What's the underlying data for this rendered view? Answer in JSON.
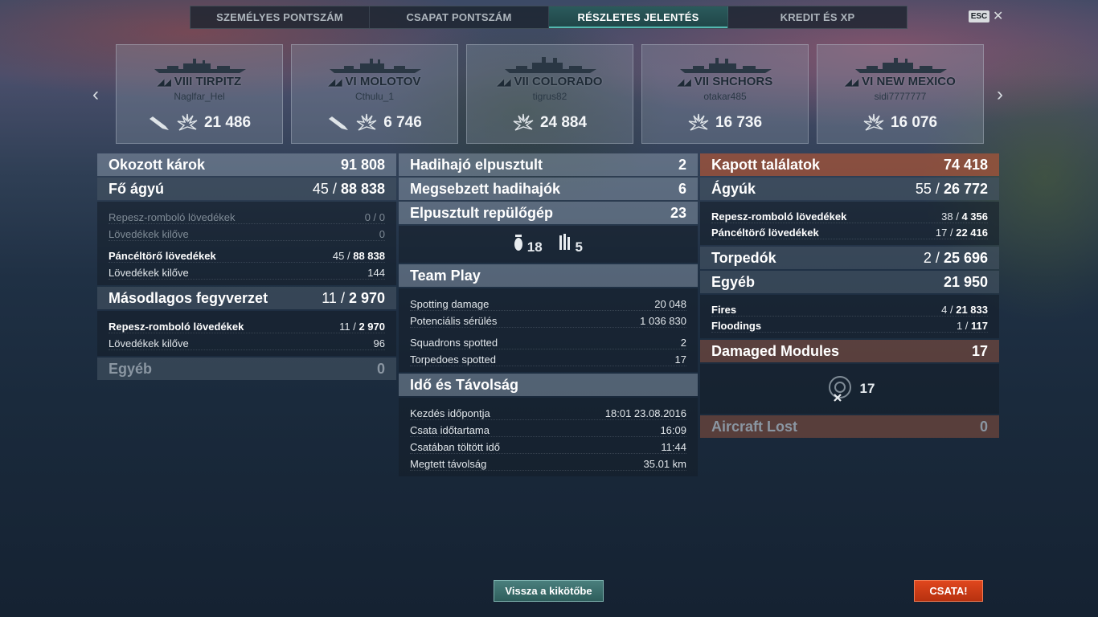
{
  "tabs": [
    {
      "label": "SZEMÉLYES PONTSZÁM",
      "active": false
    },
    {
      "label": "CSAPAT PONTSZÁM",
      "active": false
    },
    {
      "label": "RÉSZLETES JELENTÉS",
      "active": true
    },
    {
      "label": "KREDIT ÉS XP",
      "active": false
    }
  ],
  "esc_label": "ESC",
  "close_glyph": "✕",
  "nav": {
    "prev": "‹",
    "next": "›"
  },
  "ships": [
    {
      "tier": "VIII",
      "name": "TIRPITZ",
      "player": "Naglfar_Hel",
      "damage": "21 486",
      "sunk_icon": true
    },
    {
      "tier": "VI",
      "name": "MOLOTOV",
      "player": "Cthulu_1",
      "damage": "6 746",
      "sunk_icon": true
    },
    {
      "tier": "VII",
      "name": "COLORADO",
      "player": "tigrus82",
      "damage": "24 884",
      "sunk_icon": false
    },
    {
      "tier": "VII",
      "name": "SHCHORS",
      "player": "otakar485",
      "damage": "16 736",
      "sunk_icon": false
    },
    {
      "tier": "VI",
      "name": "NEW MEXICO",
      "player": "sidi7777777",
      "damage": "16 076",
      "sunk_icon": false
    }
  ],
  "left": {
    "dealt": {
      "label": "Okozott károk",
      "value": "91 808"
    },
    "main": {
      "label": "Fő ágyú",
      "hits": "45",
      "dmg": "88 838"
    },
    "he": {
      "label": "Repesz-romboló lövedékek",
      "value": "0 / 0"
    },
    "he_fired": {
      "label": "Lövedékek kilőve",
      "value": "0"
    },
    "ap": {
      "label": "Páncéltörő lövedékek",
      "hits": "45",
      "dmg": "88 838"
    },
    "ap_fired": {
      "label": "Lövedékek kilőve",
      "value": "144"
    },
    "secondary": {
      "label": "Másodlagos fegyverzet",
      "hits": "11",
      "dmg": "2 970"
    },
    "sec_he": {
      "label": "Repesz-romboló lövedékek",
      "hits": "11",
      "dmg": "2 970"
    },
    "sec_fired": {
      "label": "Lövedékek kilőve",
      "value": "96"
    },
    "other": {
      "label": "Egyéb",
      "value": "0"
    }
  },
  "middle": {
    "destroyed": {
      "label": "Hadihajó elpusztult",
      "value": "2"
    },
    "damaged": {
      "label": "Megsebzett hadihajók",
      "value": "6"
    },
    "planes": {
      "label": "Elpusztult repülőgép",
      "value": "23"
    },
    "bombs": "18",
    "torps": "5",
    "team_play": {
      "title": "Team Play",
      "spotting_damage": {
        "label": "Spotting damage",
        "value": "20 048"
      },
      "potential": {
        "label": "Potenciális sérülés",
        "value": "1 036 830"
      },
      "squadrons": {
        "label": "Squadrons spotted",
        "value": "2"
      },
      "torpedoes": {
        "label": "Torpedoes spotted",
        "value": "17"
      }
    },
    "time": {
      "title": "Idő és Távolság",
      "start": {
        "label": "Kezdés időpontja",
        "value": "18:01  23.08.2016"
      },
      "duration": {
        "label": "Csata időtartama",
        "value": "16:09"
      },
      "in_battle": {
        "label": "Csatában töltött idő",
        "value": "11:44"
      },
      "distance": {
        "label": "Megtett távolság",
        "value": "35.01 km"
      }
    }
  },
  "right": {
    "received": {
      "label": "Kapott találatok",
      "value": "74 418"
    },
    "guns": {
      "label": "Ágyúk",
      "hits": "55",
      "dmg": "26 772"
    },
    "he": {
      "label": "Repesz-romboló lövedékek",
      "hits": "38",
      "dmg": "4 356"
    },
    "ap": {
      "label": "Páncéltörő lövedékek",
      "hits": "17",
      "dmg": "22 416"
    },
    "torpedoes": {
      "label": "Torpedók",
      "hits": "2",
      "dmg": "25 696"
    },
    "other": {
      "label": "Egyéb",
      "value": "21 950"
    },
    "fires": {
      "label": "Fires",
      "hits": "4",
      "dmg": "21 833"
    },
    "floodings": {
      "label": "Floodings",
      "hits": "1",
      "dmg": "117"
    },
    "modules": {
      "label": "Damaged Modules",
      "value": "17"
    },
    "module_count": "17",
    "aircraft_lost": {
      "label": "Aircraft Lost",
      "value": "0"
    }
  },
  "buttons": {
    "port": "Vissza a kikötőbe",
    "battle": "CSATA!"
  },
  "colors": {
    "accent_teal": "#2b5a5c",
    "battle_orange": "#d2411a",
    "received_red": "#aa5537"
  }
}
